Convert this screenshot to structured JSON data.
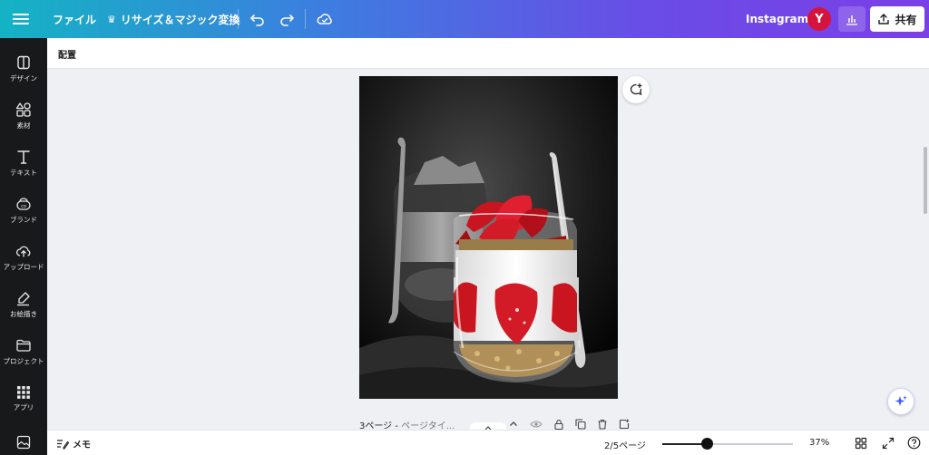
{
  "header": {
    "menu_icon": "hamburger-icon",
    "file_label": "ファイル",
    "resize_label": "リサイズ＆マジック変換",
    "design_name": "Instagram",
    "avatar_initial": "Y",
    "share_label": "共有"
  },
  "sidebar": {
    "items": [
      {
        "label": "デザイン",
        "icon": "design-icon"
      },
      {
        "label": "素材",
        "icon": "elements-icon"
      },
      {
        "label": "テキスト",
        "icon": "text-icon"
      },
      {
        "label": "ブランド",
        "icon": "brand-icon"
      },
      {
        "label": "アップロード",
        "icon": "upload-icon"
      },
      {
        "label": "お絵描き",
        "icon": "draw-icon"
      },
      {
        "label": "プロジェクト",
        "icon": "folder-icon"
      },
      {
        "label": "アプリ",
        "icon": "apps-icon"
      }
    ],
    "bottom_icon": "image-icon"
  },
  "context_bar": {
    "label": "配置"
  },
  "canvas": {
    "page_caption": "3ページ - ",
    "page_caption_placeholder": "ページタイ..."
  },
  "footer": {
    "memo_label": "メモ",
    "pages_indicator": "2/5ページ",
    "zoom_value": "37%",
    "zoom_fraction": 0.34
  },
  "colors": {
    "accent": "#7d2ae8",
    "avatar": "#d4143c",
    "sidebar_bg": "#18191b"
  }
}
